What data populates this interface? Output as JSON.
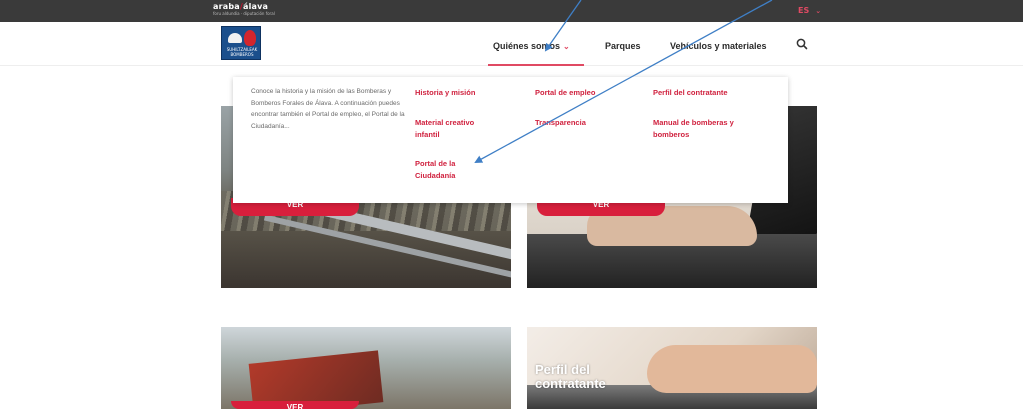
{
  "topbar": {
    "brand_main": "araba",
    "brand_accent": "/",
    "brand_secondary": "álava",
    "brand_tagline": "foru aldundia · diputación foral",
    "language": "ES",
    "language_chevron": "⌄"
  },
  "logo": {
    "text": "SUHILTZAILEAK BOMBEROS"
  },
  "nav": {
    "items": [
      {
        "label": "Quiénes somos",
        "chevron": "⌄"
      },
      {
        "label": "Parques"
      },
      {
        "label": "Vehículos y materiales"
      }
    ]
  },
  "menu": {
    "description": "Conoce la historia y la misión de las Bomberas y Bomberos Forales de Álava. A continuación puedes encontrar también el Portal de empleo, el Portal de la Ciudadanía...",
    "links": [
      {
        "label": "Historia y misión"
      },
      {
        "label": "Portal de empleo"
      },
      {
        "label": "Perfil del contratante"
      },
      {
        "label": "Material creativo infantil"
      },
      {
        "label": "Transparencia"
      },
      {
        "label": "Manual de bomberas y bomberos"
      },
      {
        "label": "Portal de la Ciudadanía"
      }
    ]
  },
  "cards": [
    {
      "button": "VER"
    },
    {
      "button": "VER"
    },
    {
      "button": "VER"
    },
    {
      "title": "Perfil del contratante"
    }
  ],
  "colors": {
    "accent": "#d81f3c",
    "topbar": "#3a3a3a",
    "link": "#d0223f",
    "arrow": "#3f7fc6"
  }
}
